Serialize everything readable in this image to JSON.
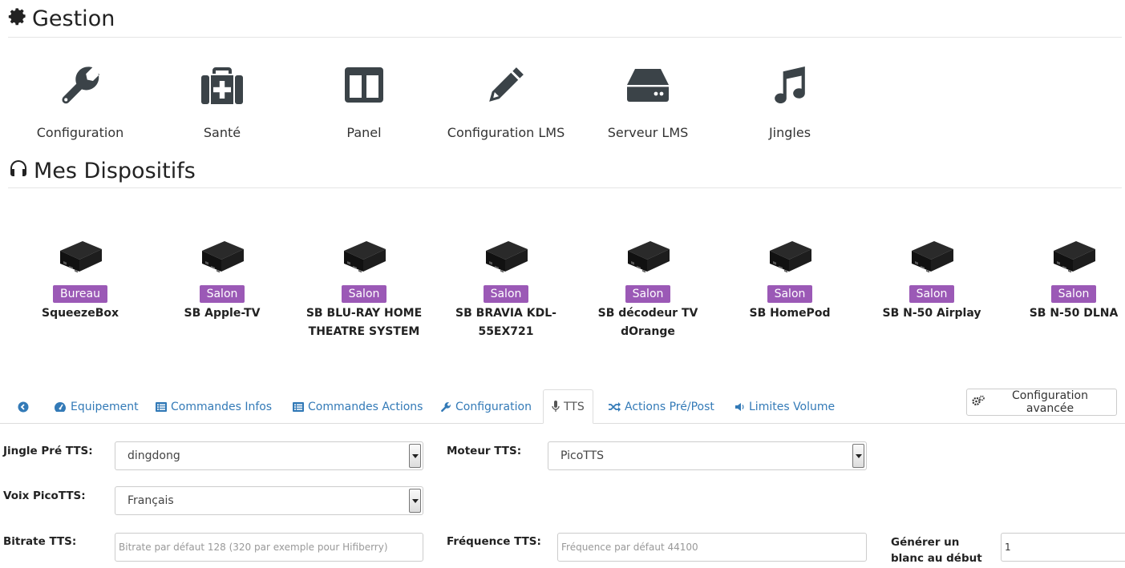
{
  "gestion": {
    "title": "Gestion",
    "items": [
      {
        "label": "Configuration",
        "icon": "wrench-icon"
      },
      {
        "label": "Santé",
        "icon": "medkit-icon"
      },
      {
        "label": "Panel",
        "icon": "columns-icon"
      },
      {
        "label": "Configuration LMS",
        "icon": "pencil-icon"
      },
      {
        "label": "Serveur LMS",
        "icon": "hdd-icon"
      },
      {
        "label": "Jingles",
        "icon": "music-icon"
      }
    ]
  },
  "devices_section": {
    "title": "Mes Dispositifs",
    "devices": [
      {
        "room": "Bureau",
        "name": "SqueezeBox"
      },
      {
        "room": "Salon",
        "name": "SB Apple-TV"
      },
      {
        "room": "Salon",
        "name": "SB BLU-RAY HOME THEATRE SYSTEM"
      },
      {
        "room": "Salon",
        "name": "SB BRAVIA KDL-55EX721"
      },
      {
        "room": "Salon",
        "name": "SB décodeur TV dOrange"
      },
      {
        "room": "Salon",
        "name": "SB HomePod"
      },
      {
        "room": "Salon",
        "name": "SB N-50 Airplay"
      },
      {
        "room": "Salon",
        "name": "SB N-50 DLNA"
      }
    ]
  },
  "tabs": [
    {
      "label": "",
      "icon": "arrow-circle-left-icon"
    },
    {
      "label": "Equipement",
      "icon": "tachometer-icon"
    },
    {
      "label": "Commandes Infos",
      "icon": "list-alt-icon"
    },
    {
      "label": "Commandes Actions",
      "icon": "list-alt-icon"
    },
    {
      "label": "Configuration",
      "icon": "wrench-icon"
    },
    {
      "label": "TTS",
      "icon": "microphone-icon",
      "active": true
    },
    {
      "label": "Actions Pré/Post",
      "icon": "random-icon"
    },
    {
      "label": "Limites Volume",
      "icon": "volume-icon"
    }
  ],
  "advanced_button": "Configuration avancée",
  "form": {
    "jingle_label": "Jingle Pré TTS:",
    "jingle_value": "dingdong",
    "engine_label": "Moteur TTS:",
    "engine_value": "PicoTTS",
    "voice_label": "Voix PicoTTS:",
    "voice_value": "Français",
    "bitrate_label": "Bitrate TTS:",
    "bitrate_placeholder": "Bitrate par défaut 128 (320 par exemple pour Hifiberry)",
    "freq_label": "Fréquence TTS:",
    "freq_placeholder": "Fréquence par défaut 44100",
    "blank_label": "Générer un blanc au début",
    "blank_value": "1"
  },
  "colors": {
    "accent": "#337ab7",
    "badge": "#9b59b6",
    "icon": "#3b4348"
  }
}
